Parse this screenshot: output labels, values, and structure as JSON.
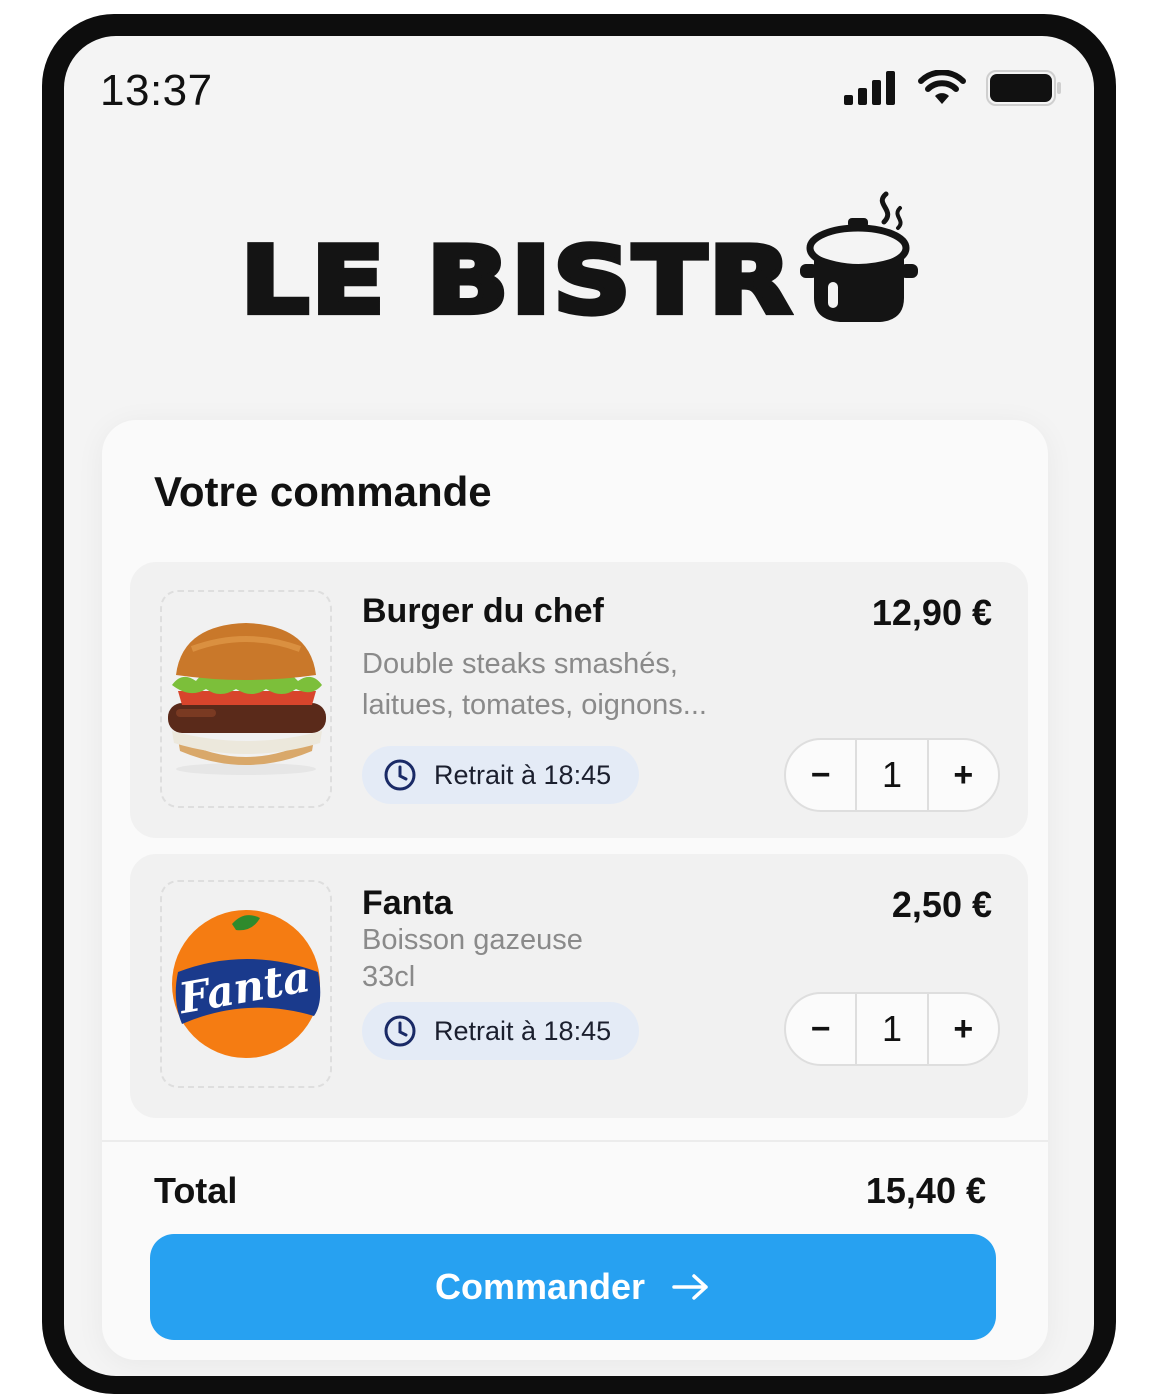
{
  "status_bar": {
    "time": "13:37"
  },
  "brand": {
    "logo_text": "LE BISTR",
    "logo_icon": "cooking-pot-icon"
  },
  "order": {
    "title": "Votre commande",
    "items": [
      {
        "name": "Burger du chef",
        "price": "12,90 €",
        "description_lines": [
          "Double steaks smashés,",
          "laitues, tomates, oignons..."
        ],
        "pickup": "Retrait à 18:45",
        "quantity": "1",
        "image": "burger-image"
      },
      {
        "name": "Fanta",
        "price": "2,50 €",
        "description_lines": [
          "Boisson gazeuse",
          "33cl"
        ],
        "pickup": "Retrait à 18:45",
        "quantity": "1",
        "image": "fanta-logo",
        "image_text": "Fanta"
      }
    ],
    "stepper": {
      "decrement": "−",
      "increment": "+"
    },
    "total_label": "Total",
    "total_value": "15,40 €",
    "cta_label": "Commander"
  },
  "colors": {
    "accent": "#27a1f1",
    "pickup_badge": "#e4ebf6",
    "fanta_orange": "#f57c12",
    "fanta_blue": "#1a3a8c"
  }
}
